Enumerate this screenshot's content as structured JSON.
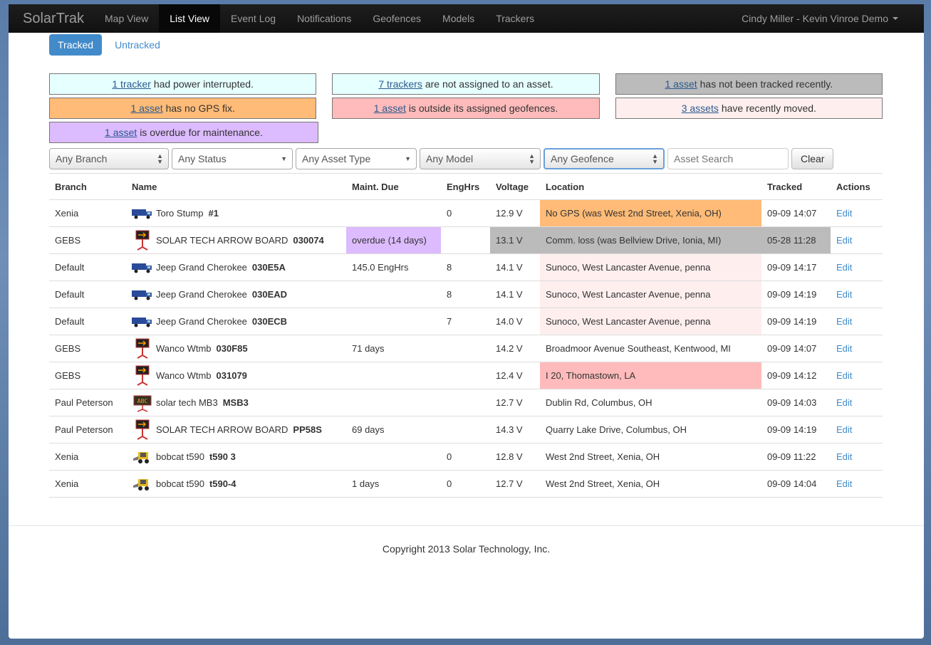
{
  "navbar": {
    "brand": "SolarTrak",
    "items": [
      "Map View",
      "List View",
      "Event Log",
      "Notifications",
      "Geofences",
      "Models",
      "Trackers"
    ],
    "active": "List View",
    "user": "Cindy Miller - Kevin Vinroe Demo"
  },
  "pills": {
    "tracked": "Tracked",
    "untracked": "Untracked"
  },
  "alerts": [
    {
      "link": "1 tracker",
      "text": "had power interrupted."
    },
    {
      "link": "7 trackers",
      "text": "are not assigned to an asset."
    },
    {
      "link": "1 asset",
      "text": "has not been tracked recently."
    },
    {
      "link": "1 asset",
      "text": "has no GPS fix."
    },
    {
      "link": "1 asset",
      "text": "is outside its assigned geofences."
    },
    {
      "link": "3 assets",
      "text": "have recently moved."
    },
    {
      "link": "1 asset",
      "text": "is overdue for maintenance."
    }
  ],
  "filters": {
    "branch": "Any Branch",
    "status": "Any Status",
    "asset_type": "Any Asset Type",
    "model": "Any Model",
    "geofence": "Any Geofence",
    "search_placeholder": "Asset Search",
    "clear": "Clear"
  },
  "table": {
    "headers": [
      "Branch",
      "Name",
      "Maint. Due",
      "EngHrs",
      "Voltage",
      "Location",
      "Tracked",
      "Actions"
    ],
    "rows": [
      {
        "branch": "Xenia",
        "name": "Toro Stump",
        "serial": "#1",
        "icon": "truck-icon",
        "maint": "",
        "enghrs": "0",
        "voltage": "12.9 V",
        "location": "No GPS (was West 2nd Street, Xenia, OH)",
        "tracked": "09-09 14:07",
        "action": "Edit"
      },
      {
        "branch": "GEBS",
        "name": "SOLAR TECH ARROW BOARD",
        "serial": "030074",
        "icon": "arrow-board-icon",
        "maint": "overdue (14 days)",
        "enghrs": "",
        "voltage": "13.1 V",
        "location": "Comm. loss (was Bellview Drive, Ionia, MI)",
        "tracked": "05-28 11:28",
        "action": "Edit"
      },
      {
        "branch": "Default",
        "name": "Jeep Grand Cherokee",
        "serial": "030E5A",
        "icon": "truck-icon",
        "maint": "145.0 EngHrs",
        "enghrs": "8",
        "voltage": "14.1 V",
        "location": "Sunoco, West Lancaster Avenue, penna",
        "tracked": "09-09 14:17",
        "action": "Edit"
      },
      {
        "branch": "Default",
        "name": "Jeep Grand Cherokee",
        "serial": "030EAD",
        "icon": "truck-icon",
        "maint": "",
        "enghrs": "8",
        "voltage": "14.1 V",
        "location": "Sunoco, West Lancaster Avenue, penna",
        "tracked": "09-09 14:19",
        "action": "Edit"
      },
      {
        "branch": "Default",
        "name": "Jeep Grand Cherokee",
        "serial": "030ECB",
        "icon": "truck-icon",
        "maint": "",
        "enghrs": "7",
        "voltage": "14.0 V",
        "location": "Sunoco, West Lancaster Avenue, penna",
        "tracked": "09-09 14:19",
        "action": "Edit"
      },
      {
        "branch": "GEBS",
        "name": "Wanco Wtmb",
        "serial": "030F85",
        "icon": "arrow-board-icon",
        "maint": "71 days",
        "enghrs": "",
        "voltage": "14.2 V",
        "location": "Broadmoor Avenue Southeast, Kentwood, MI",
        "tracked": "09-09 14:07",
        "action": "Edit"
      },
      {
        "branch": "GEBS",
        "name": "Wanco Wtmb",
        "serial": "031079",
        "icon": "arrow-board-icon",
        "maint": "",
        "enghrs": "",
        "voltage": "12.4 V",
        "location": "I 20, Thomastown, LA",
        "tracked": "09-09 14:12",
        "action": "Edit"
      },
      {
        "branch": "Paul Peterson",
        "name": "solar tech MB3",
        "serial": "MSB3",
        "icon": "message-board-icon",
        "maint": "",
        "enghrs": "",
        "voltage": "12.7 V",
        "location": "Dublin Rd, Columbus, OH",
        "tracked": "09-09 14:03",
        "action": "Edit"
      },
      {
        "branch": "Paul Peterson",
        "name": "SOLAR TECH ARROW BOARD",
        "serial": "PP58S",
        "icon": "arrow-board-icon",
        "maint": "69 days",
        "enghrs": "",
        "voltage": "14.3 V",
        "location": "Quarry Lake Drive, Columbus, OH",
        "tracked": "09-09 14:19",
        "action": "Edit"
      },
      {
        "branch": "Xenia",
        "name": "bobcat t590",
        "serial": "t590 3",
        "icon": "skid-steer-icon",
        "maint": "",
        "enghrs": "0",
        "voltage": "12.8 V",
        "location": "West 2nd Street, Xenia, OH",
        "tracked": "09-09 11:22",
        "action": "Edit"
      },
      {
        "branch": "Xenia",
        "name": "bobcat t590",
        "serial": "t590-4",
        "icon": "skid-steer-icon",
        "maint": "1 days",
        "enghrs": "0",
        "voltage": "12.7 V",
        "location": "West 2nd Street, Xenia, OH",
        "tracked": "09-09 14:04",
        "action": "Edit"
      }
    ]
  },
  "colors": {
    "orange": "#ffbb77",
    "gray": "#bbbbbb",
    "pink": "#ffeeee",
    "red": "#ffbbbb",
    "purple": "#ddbbff",
    "cyan": "#e6ffff",
    "link": "#428bca"
  },
  "footer": "Copyright 2013 Solar Technology, Inc."
}
